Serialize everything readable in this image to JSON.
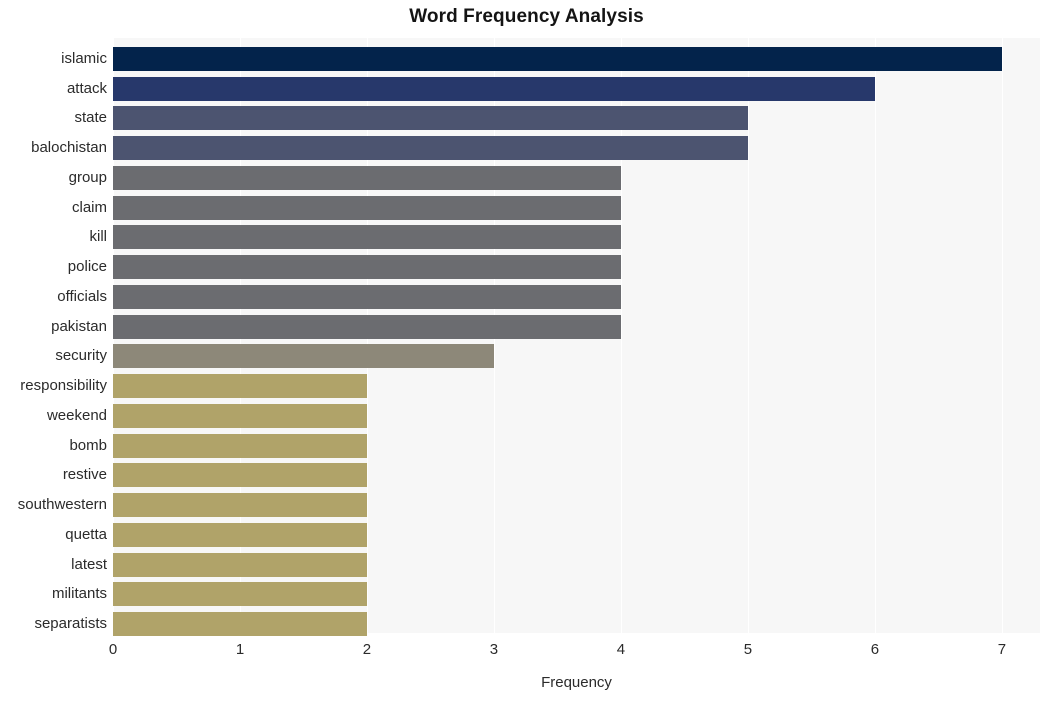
{
  "chart_data": {
    "type": "bar",
    "orientation": "horizontal",
    "title": "Word Frequency Analysis",
    "xlabel": "Frequency",
    "ylabel": "",
    "xlim": [
      0,
      7.3
    ],
    "xticks": [
      0,
      1,
      2,
      3,
      4,
      5,
      6,
      7
    ],
    "xtick_labels": [
      "0",
      "1",
      "2",
      "3",
      "4",
      "5",
      "6",
      "7"
    ],
    "grid": true,
    "grid_axis": "x",
    "legend": false,
    "categories": [
      "islamic",
      "attack",
      "state",
      "balochistan",
      "group",
      "claim",
      "kill",
      "police",
      "officials",
      "pakistan",
      "security",
      "responsibility",
      "weekend",
      "bomb",
      "restive",
      "southwestern",
      "quetta",
      "latest",
      "militants",
      "separatists"
    ],
    "values": [
      7,
      6,
      5,
      5,
      4,
      4,
      4,
      4,
      4,
      4,
      3,
      2,
      2,
      2,
      2,
      2,
      2,
      2,
      2,
      2
    ],
    "bar_colors": [
      "#03234b",
      "#27386b",
      "#4c5470",
      "#4c5470",
      "#6b6c70",
      "#6b6c70",
      "#6b6c70",
      "#6b6c70",
      "#6b6c70",
      "#6b6c70",
      "#8d8879",
      "#b0a369",
      "#b0a369",
      "#b0a369",
      "#b0a369",
      "#b0a369",
      "#b0a369",
      "#b0a369",
      "#b0a369",
      "#b0a369"
    ]
  },
  "style": {
    "plot_background": "#f7f7f7",
    "figure_background": "#ffffff",
    "gridline_color": "#ffffff",
    "text_color": "#2b2b2b",
    "title_color": "#141414"
  }
}
